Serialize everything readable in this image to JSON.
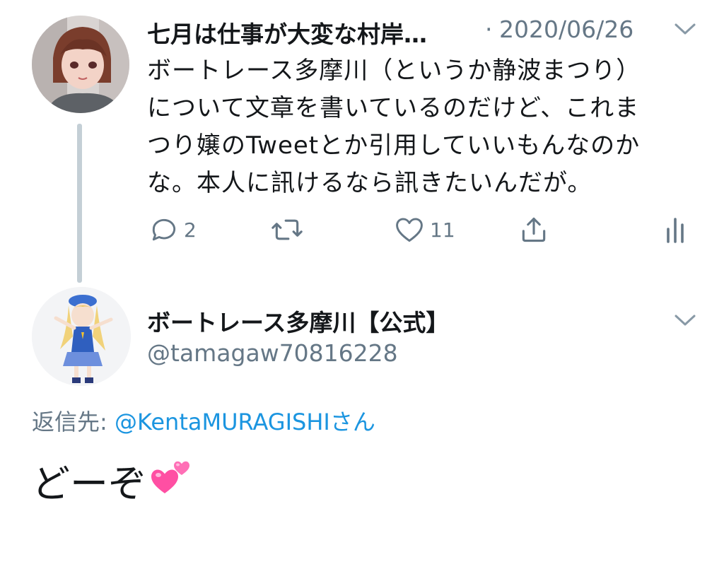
{
  "parent_tweet": {
    "display_name": "七月は仕事が大変な村岸…",
    "separator": "·",
    "date": "2020/06/26",
    "text_lines": [
      "ボートレース多摩川（というか静波まつり）",
      "について文章を書いているのだけど、これま",
      "つり嬢のTweetとか引用していいもんなのか",
      "な。本人に訊けるなら訊きたいんだが。"
    ],
    "actions": {
      "reply_count": "2",
      "retweet_count": "",
      "like_count": "11"
    }
  },
  "reply_tweet": {
    "display_name": "ボートレース多摩川【公式】",
    "handle": "@tamagaw70816228",
    "reply_to_label": "返信先: ",
    "reply_to_user": "@KentaMURAGISHI",
    "reply_to_suffix": "さん",
    "text": "どーぞ",
    "emoji": "hearts-emoji"
  },
  "colors": {
    "text": "#14171a",
    "secondary": "#657786",
    "link": "#1b95e0",
    "thread_line": "#c4cfd6",
    "heart_pink": "#ff4fa3"
  }
}
